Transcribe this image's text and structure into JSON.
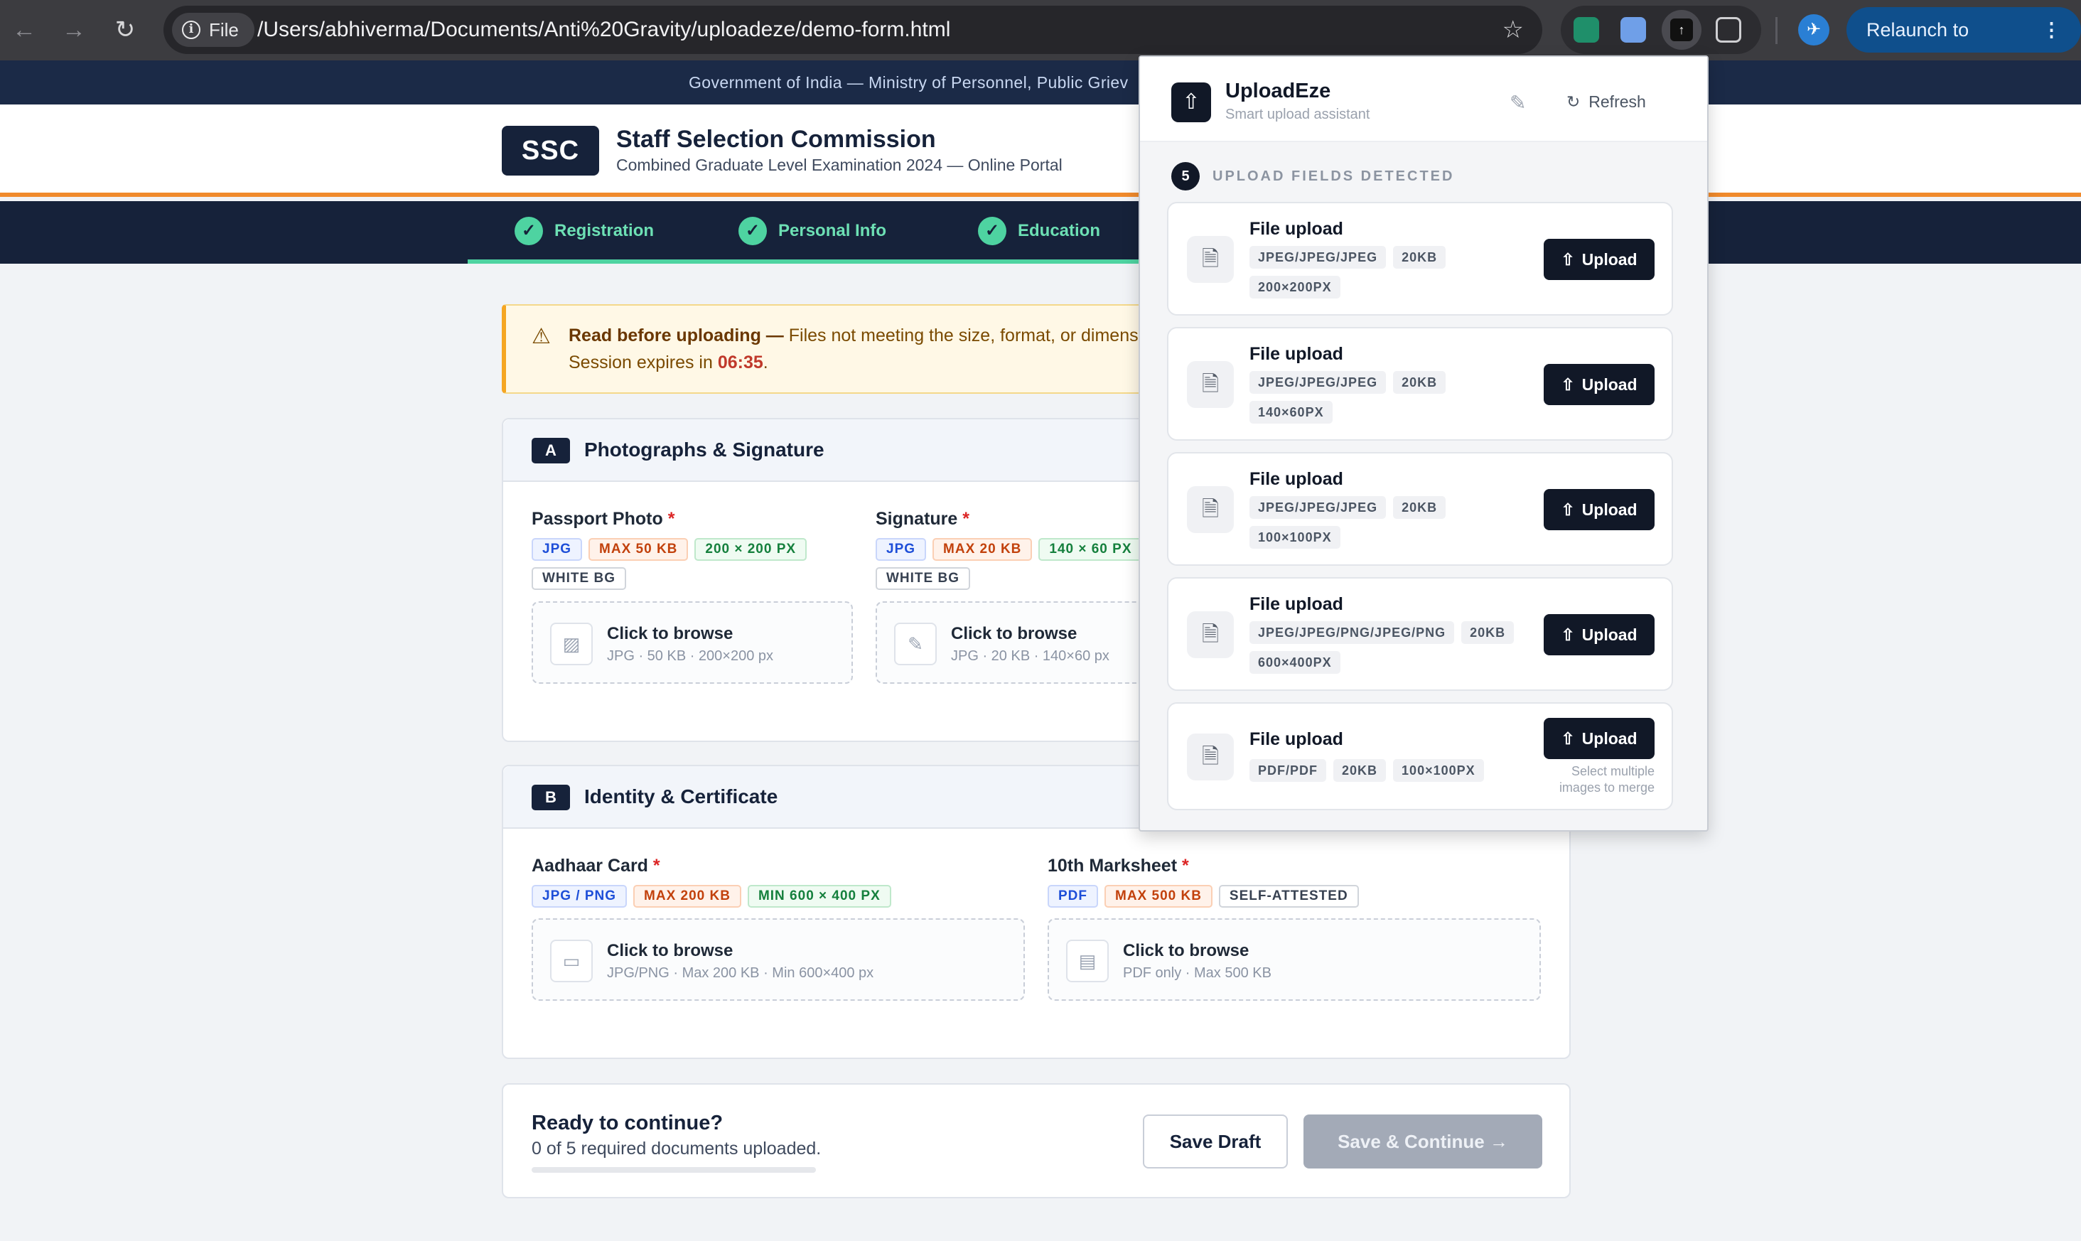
{
  "browser": {
    "file_chip": "File",
    "url": "/Users/abhiverma/Documents/Anti%20Gravity/uploadeze/demo-form.html",
    "relaunch": "Relaunch to update"
  },
  "gov_banner": "Government of India — Ministry of Personnel, Public Griev",
  "header": {
    "logo": "SSC",
    "org_name": "Staff Selection Commission",
    "org_sub": "Combined Graduate Level Examination 2024 — Online Portal"
  },
  "steps": [
    {
      "label": "Registration"
    },
    {
      "label": "Personal Info"
    },
    {
      "label": "Education"
    }
  ],
  "warning": {
    "bold": "Read before uploading —",
    "text": " Files not meeting the size, format, or dimens",
    "session_prefix": "Session expires in ",
    "time": "06:35",
    "session_suffix": "."
  },
  "section_a": {
    "letter": "A",
    "title": "Photographs & Signature",
    "fields": [
      {
        "label": "Passport Photo",
        "tags": [
          "JPG",
          "MAX 50 KB",
          "200 × 200 PX",
          "WHITE BG"
        ],
        "drop_title": "Click to browse",
        "drop_sub": "JPG · 50 KB · 200×200 px"
      },
      {
        "label": "Signature",
        "tags": [
          "JPG",
          "MAX 20 KB",
          "140 × 60 PX",
          "WHITE BG"
        ],
        "drop_title": "Click to browse",
        "drop_sub": "JPG · 20 KB · 140×60 px"
      }
    ]
  },
  "section_b": {
    "letter": "B",
    "title": "Identity & Certificate",
    "fields": [
      {
        "label": "Aadhaar Card",
        "tags": [
          "JPG / PNG",
          "MAX 200 KB",
          "MIN 600 × 400 PX"
        ],
        "drop_title": "Click to browse",
        "drop_sub": "JPG/PNG · Max 200 KB · Min 600×400 px"
      },
      {
        "label": "10th Marksheet",
        "tags": [
          "PDF",
          "MAX 500 KB",
          "SELF-ATTESTED"
        ],
        "drop_title": "Click to browse",
        "drop_sub": "PDF only · Max 500 KB"
      }
    ]
  },
  "footer": {
    "title": "Ready to continue?",
    "status": "0 of 5 required documents uploaded.",
    "progress_fraction": 0,
    "save_draft": "Save Draft",
    "save_continue": "Save & Continue →"
  },
  "popup": {
    "name": "UploadEze",
    "subtitle": "Smart upload assistant",
    "refresh": "Refresh",
    "count": "5",
    "count_label": "UPLOAD FIELDS DETECTED",
    "cards": [
      {
        "title": "File upload",
        "tags": [
          "JPEG/JPEG/JPEG",
          "20KB",
          "200×200PX"
        ],
        "button": "Upload"
      },
      {
        "title": "File upload",
        "tags": [
          "JPEG/JPEG/JPEG",
          "20KB",
          "140×60PX"
        ],
        "button": "Upload"
      },
      {
        "title": "File upload",
        "tags": [
          "JPEG/JPEG/JPEG",
          "20KB",
          "100×100PX"
        ],
        "button": "Upload"
      },
      {
        "title": "File upload",
        "tags": [
          "JPEG/JPEG/PNG/JPEG/PNG",
          "20KB",
          "600×400PX"
        ],
        "button": "Upload"
      },
      {
        "title": "File upload",
        "tags": [
          "PDF/PDF",
          "20KB",
          "100×100PX"
        ],
        "button": "Upload",
        "hint": "Select multiple images to merge"
      }
    ]
  },
  "colors": {
    "navy": "#16223a",
    "accent_orange": "#f08a2c",
    "success_green": "#4ed3a1",
    "required_red": "#dc2626"
  },
  "icons": {
    "warning": "warning-triangle-icon",
    "image": "image-icon",
    "signature": "signature-icon",
    "id_card": "id-card-icon",
    "document": "document-icon",
    "upload": "upload-icon",
    "refresh": "refresh-icon",
    "edit": "pencil-icon"
  }
}
